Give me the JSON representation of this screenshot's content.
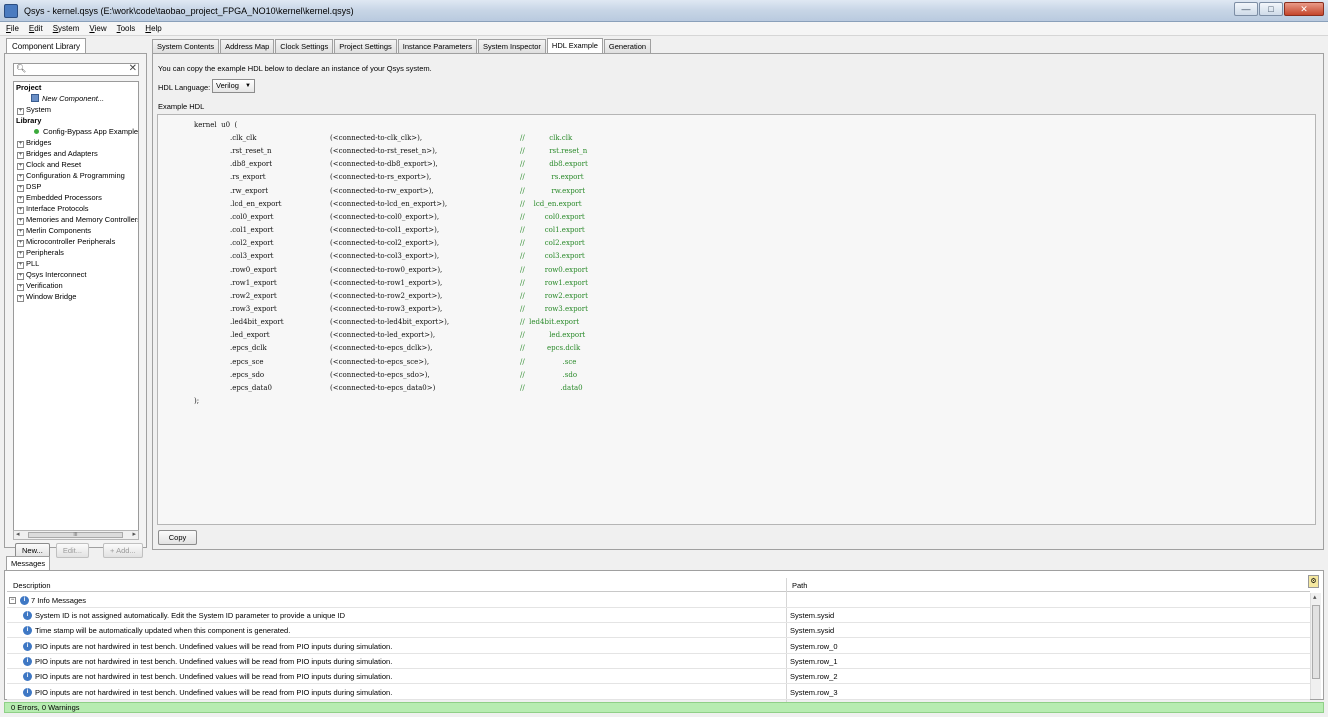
{
  "window": {
    "title": "Qsys - kernel.qsys (E:\\work\\code\\taobao_project_FPGA_NO10\\kernel\\kernel.qsys)",
    "minimize_glyph": "—",
    "maximize_glyph": "□",
    "close_glyph": "✕"
  },
  "menu": [
    {
      "key": "F",
      "rest": "ile"
    },
    {
      "key": "E",
      "rest": "dit"
    },
    {
      "key": "S",
      "rest": "ystem"
    },
    {
      "key": "V",
      "rest": "iew"
    },
    {
      "key": "T",
      "rest": "ools"
    },
    {
      "key": "H",
      "rest": "elp"
    }
  ],
  "library": {
    "tab": "Component Library",
    "search_placeholder": "",
    "tree": [
      {
        "kind": "head",
        "label": "Project"
      },
      {
        "kind": "leaf-icon",
        "label": "New Component...",
        "italic": true
      },
      {
        "kind": "branch",
        "label": "System"
      },
      {
        "kind": "head",
        "label": "Library"
      },
      {
        "kind": "dot",
        "label": "Config-Bypass App Example"
      },
      {
        "kind": "branch",
        "label": "Bridges"
      },
      {
        "kind": "branch",
        "label": "Bridges and Adapters"
      },
      {
        "kind": "branch",
        "label": "Clock and Reset"
      },
      {
        "kind": "branch",
        "label": "Configuration & Programming"
      },
      {
        "kind": "branch",
        "label": "DSP"
      },
      {
        "kind": "branch",
        "label": "Embedded Processors"
      },
      {
        "kind": "branch",
        "label": "Interface Protocols"
      },
      {
        "kind": "branch",
        "label": "Memories and Memory Controllers"
      },
      {
        "kind": "branch",
        "label": "Merlin Components"
      },
      {
        "kind": "branch",
        "label": "Microcontroller Peripherals"
      },
      {
        "kind": "branch",
        "label": "Peripherals"
      },
      {
        "kind": "branch",
        "label": "PLL"
      },
      {
        "kind": "branch",
        "label": "Qsys Interconnect"
      },
      {
        "kind": "branch",
        "label": "Verification"
      },
      {
        "kind": "branch",
        "label": "Window Bridge"
      }
    ],
    "scroll_thumb_label": "III",
    "buttons": {
      "new": "New...",
      "edit": "Edit...",
      "add": "+ Add..."
    }
  },
  "tabs": [
    {
      "label": "System Contents",
      "active": false
    },
    {
      "label": "Address Map",
      "active": false
    },
    {
      "label": "Clock Settings",
      "active": false
    },
    {
      "label": "Project Settings",
      "active": false
    },
    {
      "label": "Instance Parameters",
      "active": false
    },
    {
      "label": "System Inspector",
      "active": false
    },
    {
      "label": "HDL Example",
      "active": true
    },
    {
      "label": "Generation",
      "active": false
    }
  ],
  "hdl": {
    "intro": "You can copy the example HDL below to declare an instance of your Qsys system.",
    "language_label": "HDL Language:",
    "language_value": "Verilog",
    "example_label": "Example HDL",
    "module_line": "kernel  u0  (",
    "close_line": ");",
    "ports": [
      {
        "port": ".clk_clk",
        "conn": "(<connected-to-clk_clk>),",
        "comment": "//           clk.clk"
      },
      {
        "port": ".rst_reset_n",
        "conn": "(<connected-to-rst_reset_n>),",
        "comment": "//           rst.reset_n"
      },
      {
        "port": ".db8_export",
        "conn": "(<connected-to-db8_export>),",
        "comment": "//           db8.export"
      },
      {
        "port": ".rs_export",
        "conn": "(<connected-to-rs_export>),",
        "comment": "//            rs.export"
      },
      {
        "port": ".rw_export",
        "conn": "(<connected-to-rw_export>),",
        "comment": "//            rw.export"
      },
      {
        "port": ".lcd_en_export",
        "conn": "(<connected-to-lcd_en_export>),",
        "comment": "//    lcd_en.export"
      },
      {
        "port": ".col0_export",
        "conn": "(<connected-to-col0_export>),",
        "comment": "//         col0.export"
      },
      {
        "port": ".col1_export",
        "conn": "(<connected-to-col1_export>),",
        "comment": "//         col1.export"
      },
      {
        "port": ".col2_export",
        "conn": "(<connected-to-col2_export>),",
        "comment": "//         col2.export"
      },
      {
        "port": ".col3_export",
        "conn": "(<connected-to-col3_export>),",
        "comment": "//         col3.export"
      },
      {
        "port": ".row0_export",
        "conn": "(<connected-to-row0_export>),",
        "comment": "//         row0.export"
      },
      {
        "port": ".row1_export",
        "conn": "(<connected-to-row1_export>),",
        "comment": "//         row1.export"
      },
      {
        "port": ".row2_export",
        "conn": "(<connected-to-row2_export>),",
        "comment": "//         row2.export"
      },
      {
        "port": ".row3_export",
        "conn": "(<connected-to-row3_export>),",
        "comment": "//         row3.export"
      },
      {
        "port": ".led4bit_export",
        "conn": "(<connected-to-led4bit_export>),",
        "comment": "//  led4bit.export"
      },
      {
        "port": ".led_export",
        "conn": "(<connected-to-led_export>),",
        "comment": "//           led.export"
      },
      {
        "port": ".epcs_dclk",
        "conn": "(<connected-to-epcs_dclk>),",
        "comment": "//          epcs.dclk"
      },
      {
        "port": ".epcs_sce",
        "conn": "(<connected-to-epcs_sce>),",
        "comment": "//                 .sce"
      },
      {
        "port": ".epcs_sdo",
        "conn": "(<connected-to-epcs_sdo>),",
        "comment": "//                 .sdo"
      },
      {
        "port": ".epcs_data0",
        "conn": "(<connected-to-epcs_data0>)",
        "comment": "//                .data0"
      }
    ],
    "copy_button": "Copy"
  },
  "messages": {
    "tab": "Messages",
    "columns": {
      "description": "Description",
      "path": "Path"
    },
    "group": "7 Info Messages",
    "rows": [
      {
        "desc": "System ID is not assigned automatically. Edit the System ID parameter to provide a unique ID",
        "path": "System.sysid"
      },
      {
        "desc": "Time stamp will be automatically updated when this component is generated.",
        "path": "System.sysid"
      },
      {
        "desc": "PIO inputs are not hardwired in test bench. Undefined values will be read from PIO inputs during simulation.",
        "path": "System.row_0"
      },
      {
        "desc": "PIO inputs are not hardwired in test bench. Undefined values will be read from PIO inputs during simulation.",
        "path": "System.row_1"
      },
      {
        "desc": "PIO inputs are not hardwired in test bench. Undefined values will be read from PIO inputs during simulation.",
        "path": "System.row_2"
      },
      {
        "desc": "PIO inputs are not hardwired in test bench. Undefined values will be read from PIO inputs during simulation.",
        "path": "System.row_3"
      }
    ]
  },
  "status": "0 Errors, 0 Warnings"
}
